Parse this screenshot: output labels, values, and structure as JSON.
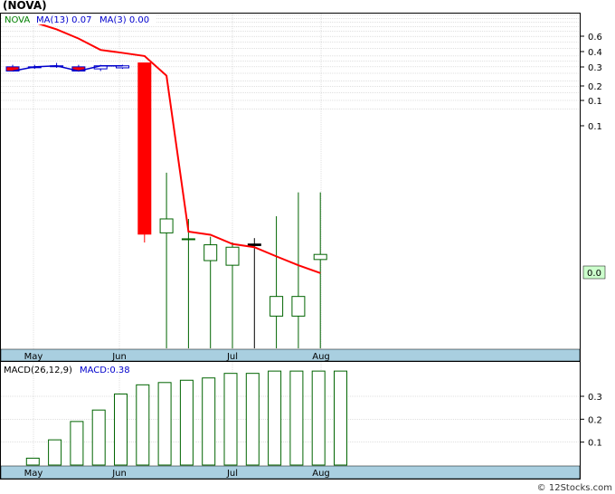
{
  "title": "(NOVA)",
  "footer": "© 12Stocks.com",
  "colors": {
    "up": "#006400",
    "down": "#ff0000",
    "ma": "#ff0000",
    "band": "#a9cfe0",
    "grid": "#c0c0c0",
    "last_box": "#ccffcc"
  },
  "chart_data": [
    {
      "type": "candlestick",
      "name": "price",
      "scale": "log",
      "legend": [
        {
          "label": "NOVA",
          "color": "#008000"
        },
        {
          "label": "MA(13)",
          "color": "#0000cc",
          "value": "0.07"
        },
        {
          "label": "MA(3)",
          "color": "#0000cc",
          "value": "0.00"
        }
      ],
      "y_ticks": [
        "0.6",
        "0.4",
        "0.3",
        "0.2",
        "0.1",
        "0.1"
      ],
      "x_ticks": [
        "May",
        "Jun",
        "Jul",
        "Aug"
      ],
      "last_value_label": "0.0",
      "ohlc": [
        {
          "o": 0.24,
          "h": 0.25,
          "l": 0.23,
          "c": 0.22
        },
        {
          "o": 0.24,
          "h": 0.25,
          "l": 0.23,
          "c": 0.24
        },
        {
          "o": 0.245,
          "h": 0.26,
          "l": 0.235,
          "c": 0.245
        },
        {
          "o": 0.24,
          "h": 0.25,
          "l": 0.225,
          "c": 0.22
        },
        {
          "o": 0.23,
          "h": 0.25,
          "l": 0.22,
          "c": 0.245
        },
        {
          "o": 0.235,
          "h": 0.25,
          "l": 0.23,
          "c": 0.245
        },
        {
          "o": 0.26,
          "h": 0.26,
          "l": 0.0064,
          "c": 0.0076
        },
        {
          "o": 0.0078,
          "h": 0.027,
          "l": 0.00072,
          "c": 0.0104
        },
        {
          "o": 0.0069,
          "h": 0.0104,
          "l": 0.00072,
          "c": 0.0069
        },
        {
          "o": 0.0044,
          "h": 0.0072,
          "l": 0.00072,
          "c": 0.0061
        },
        {
          "o": 0.004,
          "h": 0.0064,
          "l": 0.00072,
          "c": 0.0058
        },
        {
          "o": 0.0062,
          "h": 0.007,
          "l": 0.00072,
          "c": 0.006
        },
        {
          "o": 0.0014,
          "h": 0.011,
          "l": 0.00072,
          "c": 0.0021
        },
        {
          "o": 0.0014,
          "h": 0.018,
          "l": 0.00072,
          "c": 0.0021
        },
        {
          "o": 0.0045,
          "h": 0.018,
          "l": 0.00072,
          "c": 0.005
        }
      ],
      "ma_line": [
        0.67,
        0.6,
        0.52,
        0.43,
        0.34,
        0.32,
        0.3,
        0.2,
        0.008,
        0.0075,
        0.0062,
        0.0058,
        0.0048,
        0.004,
        0.0034
      ]
    },
    {
      "type": "bar",
      "name": "macd",
      "legend": [
        {
          "label": "MACD(26,12,9)",
          "color": "#000000"
        },
        {
          "label": "MACD:0.38",
          "color": "#0000cc"
        }
      ],
      "y_ticks": [
        "0.3",
        "0.2",
        "0.1"
      ],
      "x_ticks": [
        "May",
        "Jun",
        "Jul",
        "Aug"
      ],
      "values": [
        0.0,
        0.03,
        0.11,
        0.19,
        0.24,
        0.31,
        0.35,
        0.36,
        0.37,
        0.38,
        0.4,
        0.4,
        0.41,
        0.41,
        0.41,
        0.41
      ]
    }
  ]
}
